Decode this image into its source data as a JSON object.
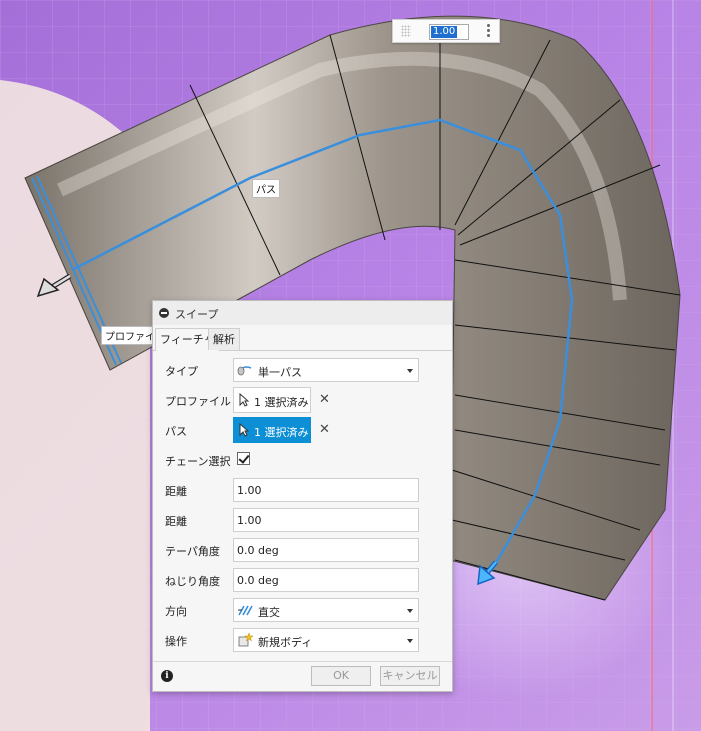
{
  "canvas": {
    "path_label": "パス",
    "profile_label": "プロファイル",
    "value_input": "1.00"
  },
  "dialog": {
    "title": "スイープ",
    "tabs": [
      {
        "label": "フィーチャ",
        "active": true
      },
      {
        "label": "解析",
        "active": false
      }
    ],
    "type": {
      "label": "タイプ",
      "value": "単一パス"
    },
    "profile": {
      "label": "プロファイル",
      "value": "1 選択済み"
    },
    "path": {
      "label": "パス",
      "value": "1 選択済み"
    },
    "chain": {
      "label": "チェーン選択",
      "checked": true
    },
    "distance1": {
      "label": "距離",
      "value": "1.00"
    },
    "distance2": {
      "label": "距離",
      "value": "1.00"
    },
    "taper": {
      "label": "テーパ角度",
      "value": "0.0 deg"
    },
    "twist": {
      "label": "ねじり角度",
      "value": "0.0 deg"
    },
    "orientation": {
      "label": "方向",
      "value": "直交"
    },
    "operation": {
      "label": "操作",
      "value": "新規ボディ"
    },
    "ok_label": "OK",
    "cancel_label": "キャンセル"
  },
  "colors": {
    "accent": "#0d8fd6",
    "path_line": "#3a8fdc",
    "background_purple": "#b07ce0"
  }
}
